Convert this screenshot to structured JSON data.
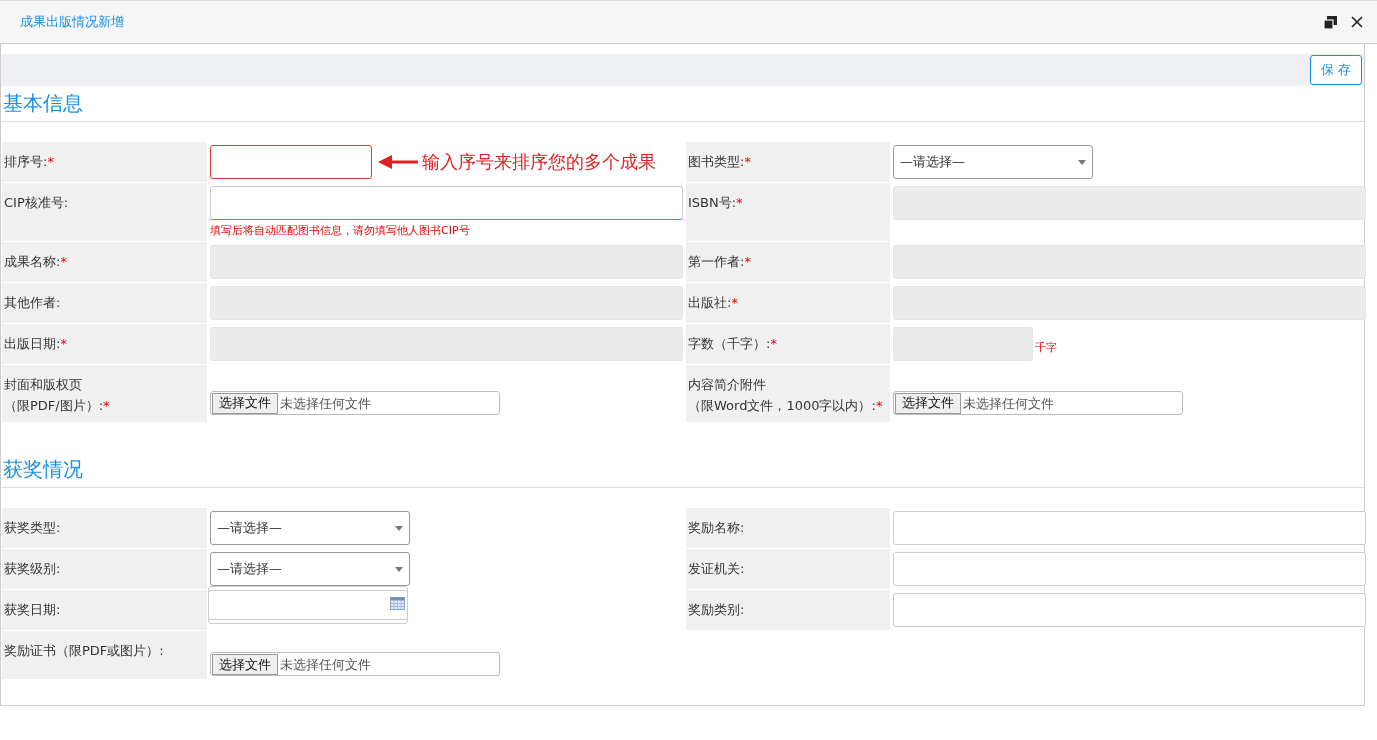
{
  "dialog": {
    "title": "成果出版情况新增"
  },
  "toolbar": {
    "save_label": "保 存"
  },
  "sections": [
    {
      "title": "基本信息",
      "rows": [
        {
          "items": [
            {
              "label": "排序号:",
              "required_mark": "*",
              "field": {
                "kind": "input",
                "invalid": true,
                "annotation": "输入序号来排序您的多个成果"
              }
            },
            {
              "label": "图书类型:",
              "required_mark": "*",
              "field": {
                "kind": "select",
                "value": "—请选择—"
              }
            }
          ]
        },
        {
          "items": [
            {
              "label": "CIP核准号:",
              "field": {
                "kind": "input",
                "invalid": false,
                "valid": true,
                "hint": "填写后将自动匹配图书信息，请勿填写他人图书CIP号"
              }
            },
            {
              "label": "ISBN号:",
              "required_mark": "*",
              "field": {
                "kind": "readonly"
              }
            }
          ]
        },
        {
          "items": [
            {
              "label": "成果名称:",
              "required_mark": "*",
              "field": {
                "kind": "readonly"
              }
            },
            {
              "label": "第一作者:",
              "required_mark": "*",
              "field": {
                "kind": "readonly"
              }
            }
          ]
        },
        {
          "items": [
            {
              "label": "其他作者:",
              "field": {
                "kind": "readonly"
              }
            },
            {
              "label": "出版社:",
              "required_mark": "*",
              "field": {
                "kind": "readonly"
              }
            }
          ]
        },
        {
          "items": [
            {
              "label": "出版日期:",
              "required_mark": "*",
              "field": {
                "kind": "readonly"
              }
            },
            {
              "label": "字数（千字）:",
              "required_mark": "*",
              "field": {
                "kind": "readonly",
                "suffix": "千字"
              }
            }
          ]
        },
        {
          "items": [
            {
              "label": "封面和版权页",
              "label_note": "（限PDF/图片）:",
              "required_mark": "*",
              "field": {
                "kind": "file",
                "button": "选择文件",
                "status": "未选择任何文件"
              }
            },
            {
              "label": "内容简介附件",
              "label_note": "（限Word文件，1000字以内）:",
              "required_mark": "*",
              "field": {
                "kind": "file",
                "button": "选择文件",
                "status": "未选择任何文件"
              }
            }
          ]
        }
      ]
    },
    {
      "title": "获奖情况",
      "rows": [
        {
          "items": [
            {
              "label": "获奖类型:",
              "field": {
                "kind": "select",
                "value": "—请选择—"
              }
            },
            {
              "label": "奖励名称:",
              "field": {
                "kind": "input"
              }
            }
          ]
        },
        {
          "items": [
            {
              "label": "获奖级别:",
              "field": {
                "kind": "select",
                "value": "—请选择—"
              }
            },
            {
              "label": "发证机关:",
              "field": {
                "kind": "input"
              }
            }
          ]
        },
        {
          "items": [
            {
              "label": "获奖日期:",
              "field": {
                "kind": "date"
              }
            },
            {
              "label": "奖励类别:",
              "field": {
                "kind": "input"
              }
            }
          ]
        },
        {
          "items": [
            {
              "label": "奖励证书（限PDF或图片）:",
              "field": {
                "kind": "file",
                "button": "选择文件",
                "status": "未选择任何文件"
              }
            }
          ]
        }
      ]
    }
  ]
}
